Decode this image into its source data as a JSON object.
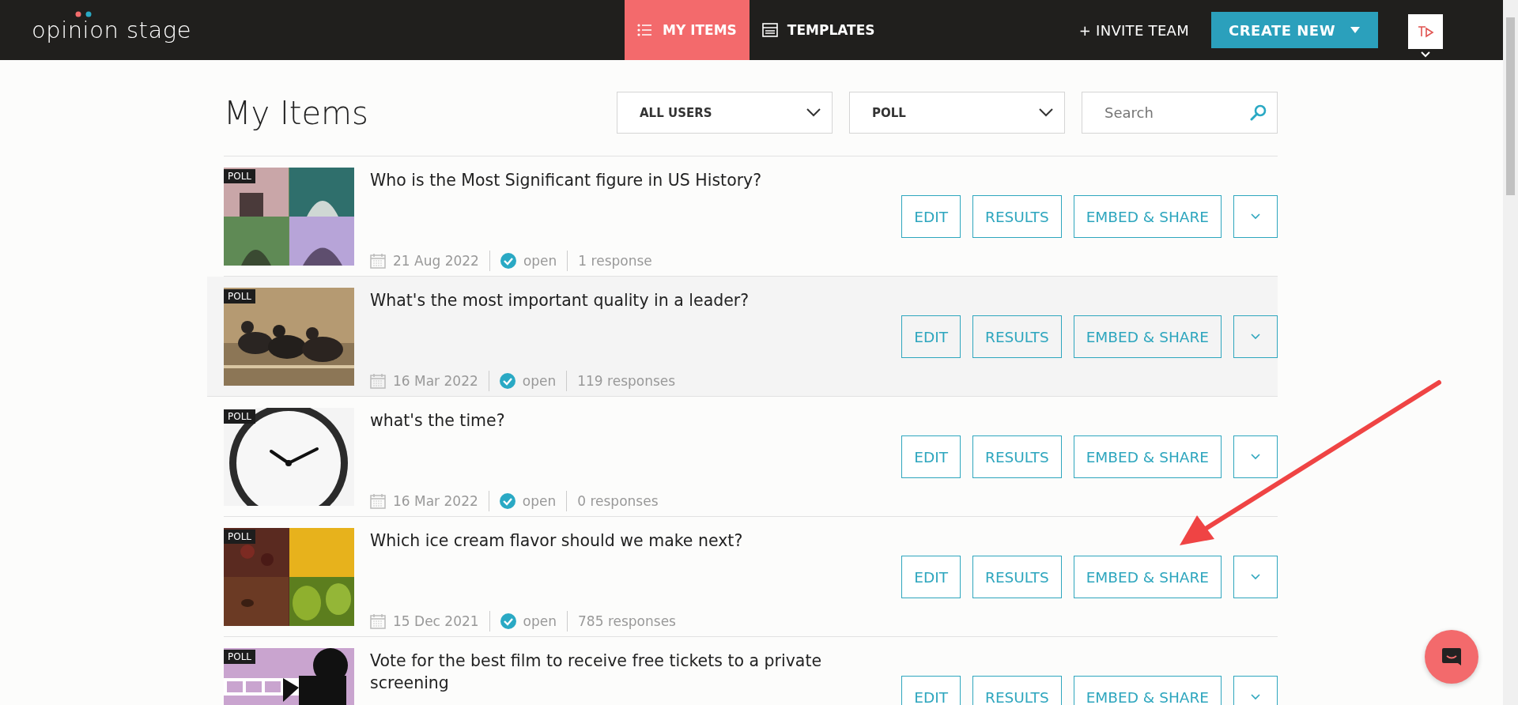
{
  "header": {
    "logo": "opinion stage",
    "tabs": [
      {
        "label": "MY ITEMS",
        "selected": true
      },
      {
        "label": "TEMPLATES",
        "selected": false
      }
    ],
    "invite": "+ INVITE TEAM",
    "create": "CREATE NEW"
  },
  "page_title": "My Items",
  "filters": [
    {
      "value": "ALL USERS"
    },
    {
      "value": "POLL"
    }
  ],
  "search": {
    "placeholder": "Search"
  },
  "items": [
    {
      "badge": "POLL",
      "title": "Who is the Most Significant figure in US History?",
      "date": "21 Aug 2022",
      "status": "open",
      "responses": "1 response",
      "highlighted": false,
      "buttons": [
        "EDIT",
        "RESULTS",
        "EMBED & SHARE"
      ]
    },
    {
      "badge": "POLL",
      "title": "What's the most important quality in a leader?",
      "date": "16 Mar 2022",
      "status": "open",
      "responses": "119 responses",
      "highlighted": true,
      "buttons": [
        "EDIT",
        "RESULTS",
        "EMBED & SHARE"
      ]
    },
    {
      "badge": "POLL",
      "title": "what's the time?",
      "date": "16 Mar 2022",
      "status": "open",
      "responses": "0 responses",
      "highlighted": false,
      "buttons": [
        "EDIT",
        "RESULTS",
        "EMBED & SHARE"
      ]
    },
    {
      "badge": "POLL",
      "title": "Which ice cream flavor should we make next?",
      "date": "15 Dec 2021",
      "status": "open",
      "responses": "785 responses",
      "highlighted": false,
      "buttons": [
        "EDIT",
        "RESULTS",
        "EMBED & SHARE"
      ]
    },
    {
      "badge": "POLL",
      "title": "Vote for the best film to receive free tickets to a private screening",
      "highlighted": false,
      "buttons": [
        "EDIT",
        "RESULTS",
        "EMBED & SHARE"
      ]
    }
  ]
}
